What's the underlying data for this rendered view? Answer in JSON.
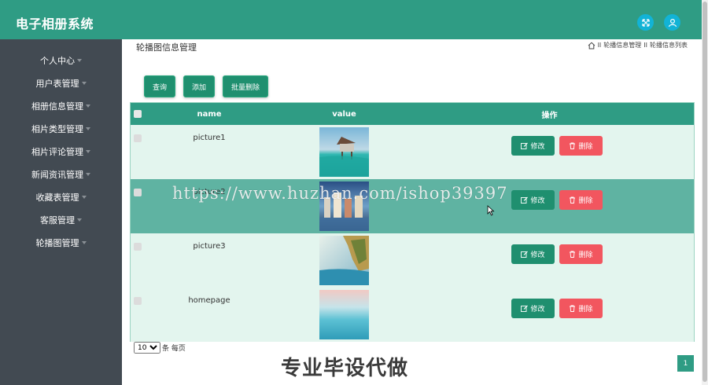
{
  "header": {
    "title": "电子相册系统",
    "icons": [
      "fullscreen-icon",
      "user-icon"
    ],
    "bg_color": "#2f9c84",
    "icon_bg": "#12b3d6"
  },
  "sidebar": {
    "bg_color": "#424a52",
    "items": [
      {
        "label": "个人中心"
      },
      {
        "label": "用户表管理"
      },
      {
        "label": "相册信息管理"
      },
      {
        "label": "相片类型管理"
      },
      {
        "label": "相片评论管理"
      },
      {
        "label": "新闻资讯管理"
      },
      {
        "label": "收藏表管理"
      },
      {
        "label": "客服管理"
      },
      {
        "label": "轮播图管理"
      }
    ]
  },
  "page": {
    "title": "轮播图信息管理",
    "breadcrumb": [
      "轮播信息管理",
      "轮播信息列表"
    ],
    "breadcrumb_separator": "II"
  },
  "toolbar": {
    "query_label": "查询",
    "add_label": "添加",
    "batch_delete_label": "批量删除"
  },
  "table": {
    "columns": [
      "name",
      "value",
      "操作"
    ],
    "rows": [
      {
        "name": "picture1",
        "edit_label": "修改",
        "delete_label": "删除",
        "image": "beach-hut-image"
      },
      {
        "name": "picture2",
        "edit_label": "修改",
        "delete_label": "删除",
        "image": "city-night-image"
      },
      {
        "name": "picture3",
        "edit_label": "修改",
        "delete_label": "删除",
        "image": "cliff-sea-image"
      },
      {
        "name": "homepage",
        "edit_label": "修改",
        "delete_label": "删除",
        "image": "sea-sky-image"
      }
    ],
    "header_color": "#2f9c84",
    "row_color": "#e3f5ee",
    "highlight_row_color": "#5fb3a2",
    "edit_color": "#1f8f6f",
    "delete_color": "#f2565f"
  },
  "pagination": {
    "page_size": "10",
    "page_size_suffix": "条 每页",
    "current_page": "1"
  },
  "overlay": {
    "watermark": "https://www.huzhan.com/ishop39397",
    "banner": "专业毕设代做"
  }
}
